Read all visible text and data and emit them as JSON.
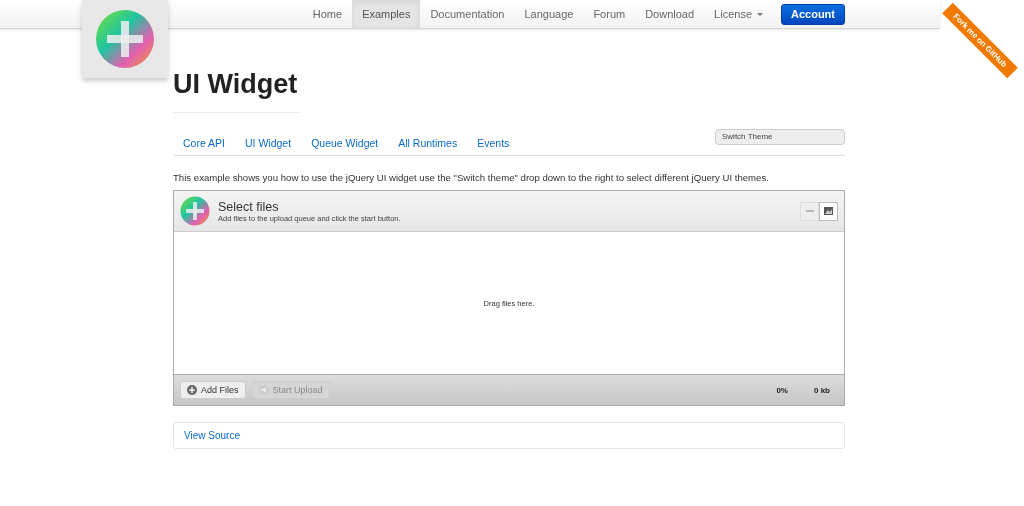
{
  "nav": {
    "items": [
      {
        "label": "Home",
        "selected": false,
        "dropdown": false
      },
      {
        "label": "Examples",
        "selected": true,
        "dropdown": false
      },
      {
        "label": "Documentation",
        "selected": false,
        "dropdown": false
      },
      {
        "label": "Language",
        "selected": false,
        "dropdown": false
      },
      {
        "label": "Forum",
        "selected": false,
        "dropdown": false
      },
      {
        "label": "Download",
        "selected": false,
        "dropdown": false
      },
      {
        "label": "License",
        "selected": false,
        "dropdown": true
      }
    ],
    "account_button": "Account"
  },
  "ribbon": "Fork me on GitHub",
  "page_title": "UI Widget",
  "subnav": {
    "tabs": [
      "Core API",
      "UI Widget",
      "Queue Widget",
      "All Runtimes",
      "Events"
    ],
    "theme_select": {
      "value": "Switch Theme"
    }
  },
  "description": "This example shows you how to use the jQuery UI widget use the \"Switch theme\" drop down to the right to select different jQuery UI themes.",
  "uploader": {
    "title": "Select files",
    "subtitle": "Add files to the upload queue and click the start button.",
    "views": [
      {
        "kind": "list",
        "selected": false
      },
      {
        "kind": "thumbs",
        "selected": true
      }
    ],
    "drop_hint": "Drag files here.",
    "buttons": [
      {
        "label": "Add Files",
        "disabled": false
      },
      {
        "label": "Start Upload",
        "disabled": true
      }
    ],
    "percent": "0%",
    "size": "0 kb"
  },
  "view_source": "View Source"
}
